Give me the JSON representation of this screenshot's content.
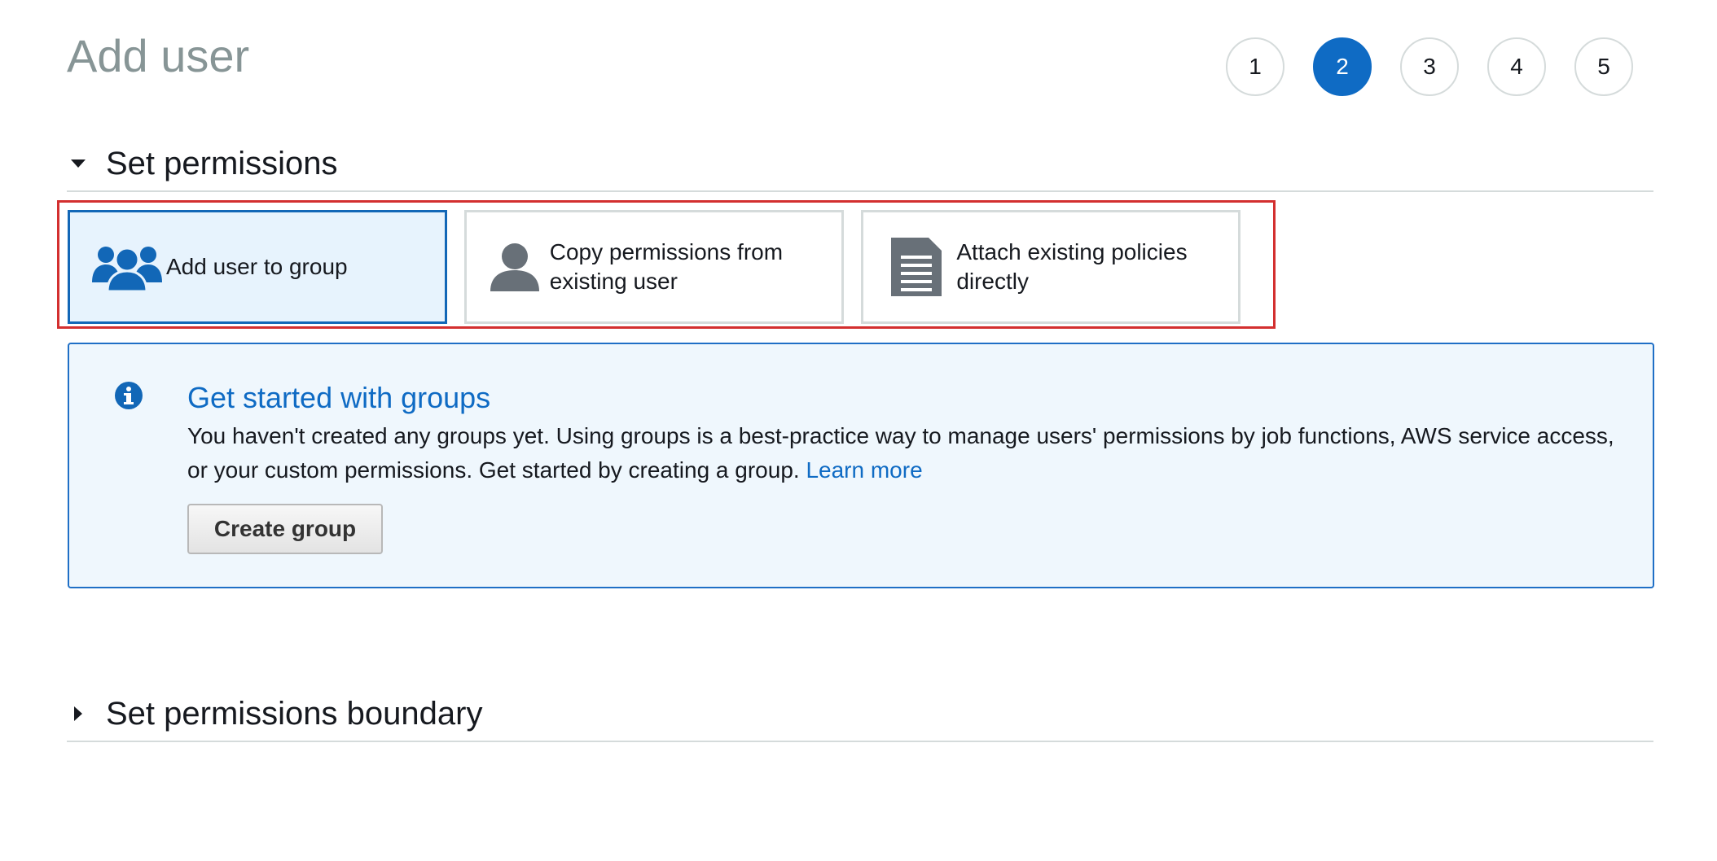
{
  "page": {
    "title": "Add user"
  },
  "steps": [
    {
      "label": "1",
      "active": false
    },
    {
      "label": "2",
      "active": true
    },
    {
      "label": "3",
      "active": false
    },
    {
      "label": "4",
      "active": false
    },
    {
      "label": "5",
      "active": false
    }
  ],
  "set_permissions": {
    "title": "Set permissions",
    "expanded": true,
    "options": [
      {
        "label": "Add user to group",
        "icon": "users-group-icon",
        "selected": true
      },
      {
        "label": "Copy permissions from existing user",
        "icon": "user-icon",
        "selected": false
      },
      {
        "label": "Attach existing policies directly",
        "icon": "document-icon",
        "selected": false
      }
    ]
  },
  "info": {
    "icon": "info-icon",
    "title": "Get started with groups",
    "text": "You haven't created any groups yet. Using groups is a best-practice way to manage users' permissions by job functions, AWS service access, or your custom permissions. Get started by creating a group.",
    "link": "Learn more",
    "button": "Create group"
  },
  "permissions_boundary": {
    "title": "Set permissions boundary",
    "expanded": false
  },
  "colors": {
    "accent": "#0f6bc4",
    "selected_bg": "#e7f3fd",
    "info_bg": "#eff7fd",
    "highlight": "#d32f2f",
    "muted_icon": "#687078"
  }
}
